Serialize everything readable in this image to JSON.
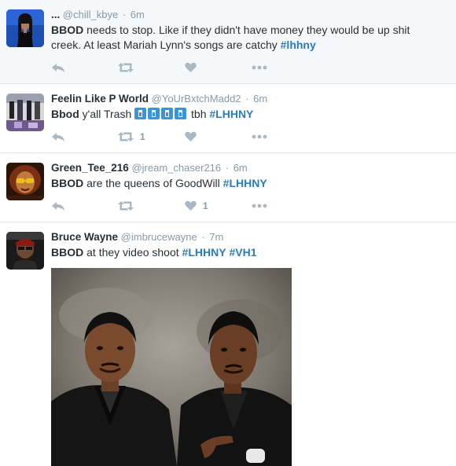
{
  "tweets": [
    {
      "name": "...",
      "handle": "@chill_kbye",
      "time": "6m",
      "text_parts": [
        "BBOD",
        " needs to stop. Like if they didn't have money they would be up shit creek. At least Mariah Lynn's songs are catchy ",
        "#lhhny"
      ],
      "reply_count": "",
      "retweet_count": "",
      "like_count": ""
    },
    {
      "name": "Feelin Like P World",
      "handle": "@YoUrBxtchMadd2",
      "time": "6m",
      "text_parts": [
        "Bbod",
        " y'all Trash ",
        " tbh ",
        "#LHHNY"
      ],
      "reply_count": "",
      "retweet_count": "1",
      "like_count": ""
    },
    {
      "name": "Green_Tee_216",
      "handle": "@jream_chaser216",
      "time": "6m",
      "text_parts": [
        "BBOD",
        " are the queens of GoodWill ",
        "#LHHNY"
      ],
      "reply_count": "",
      "retweet_count": "",
      "like_count": "1"
    },
    {
      "name": "Bruce Wayne",
      "handle": "@imbrucewayne",
      "time": "7m",
      "text_parts": [
        "BBOD",
        " at they video shoot ",
        "#LHHNY",
        " ",
        "#VH1"
      ]
    }
  ],
  "icons": {
    "reply": "reply-icon",
    "retweet": "retweet-icon",
    "like": "heart-icon",
    "more": "more-icon"
  },
  "colors": {
    "hashtag": "#2b7bb9",
    "action": "#aab8c2",
    "highlight_bg": "#f5f8fa"
  }
}
